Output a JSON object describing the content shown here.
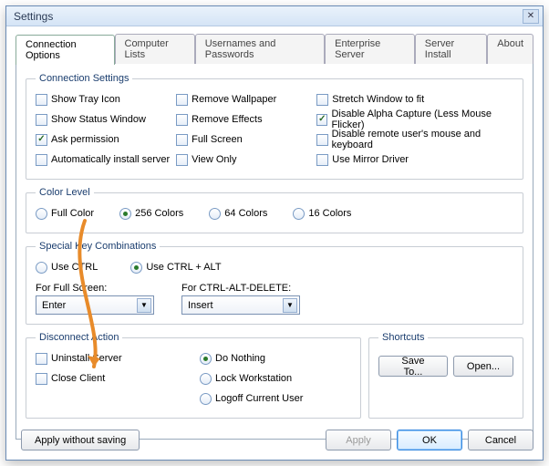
{
  "window": {
    "title": "Settings"
  },
  "tabs": {
    "items": [
      {
        "label": "Connection Options"
      },
      {
        "label": "Computer Lists"
      },
      {
        "label": "Usernames and Passwords"
      },
      {
        "label": "Enterprise Server"
      },
      {
        "label": "Server Install"
      },
      {
        "label": "About"
      }
    ]
  },
  "conn": {
    "legend": "Connection Settings",
    "checks": [
      {
        "label": "Show Tray Icon",
        "checked": false
      },
      {
        "label": "Show Status Window",
        "checked": false
      },
      {
        "label": "Ask permission",
        "checked": true
      },
      {
        "label": "Automatically install server",
        "checked": false
      },
      {
        "label": "Remove Wallpaper",
        "checked": false
      },
      {
        "label": "Remove Effects",
        "checked": false
      },
      {
        "label": "Full Screen",
        "checked": false
      },
      {
        "label": "View Only",
        "checked": false
      },
      {
        "label": "Stretch Window to fit",
        "checked": false
      },
      {
        "label": "Disable Alpha Capture (Less Mouse Flicker)",
        "checked": true
      },
      {
        "label": "Disable remote user's mouse and keyboard",
        "checked": false
      },
      {
        "label": "Use Mirror Driver",
        "checked": false
      }
    ]
  },
  "color": {
    "legend": "Color Level",
    "options": [
      {
        "label": "Full Color",
        "selected": false
      },
      {
        "label": "256 Colors",
        "selected": true
      },
      {
        "label": "64 Colors",
        "selected": false
      },
      {
        "label": "16 Colors",
        "selected": false
      }
    ]
  },
  "keys": {
    "legend": "Special Key Combinations",
    "options": [
      {
        "label": "Use CTRL",
        "selected": false
      },
      {
        "label": "Use CTRL + ALT",
        "selected": true
      }
    ],
    "fullscreen_label": "For Full Screen:",
    "fullscreen_value": "Enter",
    "cad_label": "For CTRL-ALT-DELETE:",
    "cad_value": "Insert"
  },
  "disconnect": {
    "legend": "Disconnect Action",
    "checks": [
      {
        "label": "Uninstall Server",
        "checked": false
      },
      {
        "label": "Close Client",
        "checked": false
      }
    ],
    "options": [
      {
        "label": "Do Nothing",
        "selected": true
      },
      {
        "label": "Lock Workstation",
        "selected": false
      },
      {
        "label": "Logoff Current User",
        "selected": false
      }
    ]
  },
  "shortcuts": {
    "legend": "Shortcuts",
    "save": "Save To...",
    "open": "Open..."
  },
  "buttons": {
    "apply_without": "Apply without saving",
    "apply": "Apply",
    "ok": "OK",
    "cancel": "Cancel"
  }
}
